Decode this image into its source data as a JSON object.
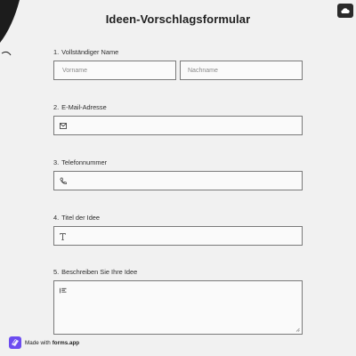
{
  "form": {
    "title": "Ideen-Vorschlagsformular",
    "fields": [
      {
        "number": "1.",
        "label": "Vollständiger Name",
        "placeholder_first": "Vorname",
        "placeholder_last": "Nachname"
      },
      {
        "number": "2.",
        "label": "E-Mail-Adresse",
        "icon": "email-icon"
      },
      {
        "number": "3.",
        "label": "Telefonnummer",
        "icon": "phone-icon"
      },
      {
        "number": "4.",
        "label": "Titel der Idee",
        "icon": "text-icon"
      },
      {
        "number": "5.",
        "label": "Beschreiben Sie Ihre Idee",
        "icon": "paragraph-icon"
      }
    ]
  },
  "badge": {
    "prefix": "Made with",
    "brand": "forms.app"
  },
  "colors": {
    "background": "#f1f1f1",
    "border": "#7a7a7a",
    "accent": "#6c4cf0"
  }
}
